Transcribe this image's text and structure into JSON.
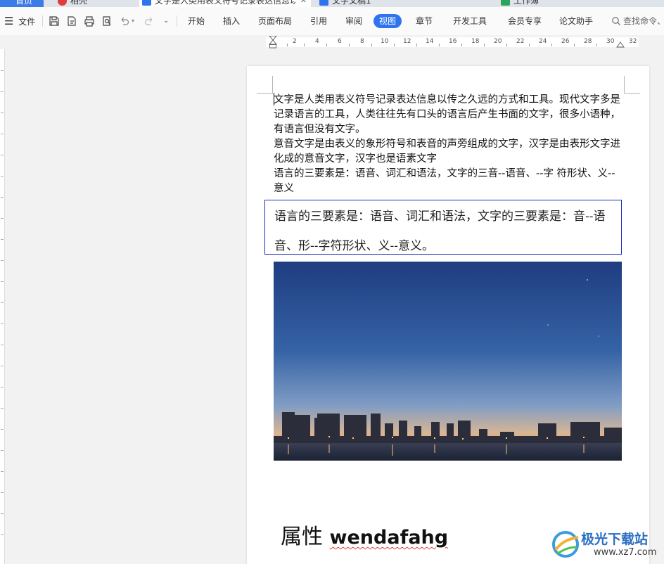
{
  "tabs": [
    {
      "label": "首页"
    },
    {
      "label": "稻壳"
    },
    {
      "label": "文字是人类用表义符号记录表达信息以传之久远的方式和工具"
    },
    {
      "label": "文字文稿1"
    },
    {
      "label": "工作簿"
    }
  ],
  "toolbar": {
    "menu_label": "文件",
    "search_label": "查找命令、",
    "menus": [
      "开始",
      "插入",
      "页面布局",
      "引用",
      "审阅",
      "视图",
      "章节",
      "开发工具",
      "会员专享",
      "论文助手"
    ],
    "active_menu": "视图"
  },
  "ruler": {
    "numbers": [
      "2",
      "2",
      "4",
      "6",
      "8",
      "10",
      "12",
      "14",
      "16",
      "18",
      "20",
      "22",
      "24",
      "26",
      "28",
      "30",
      "32"
    ]
  },
  "document": {
    "paragraphs": [
      "文字是人类用表义符号记录表达信息以传之久远的方式和工具。现代文字多是记录语言的工具，人类往往先有口头的语言后产生书面的文字，很多小语种，有语言但没有文字。",
      "意音文字是由表义的象形符号和表音的声旁组成的文字，汉字是由表形文字进化成的意音文字，汉字也是语素文字",
      "语言的三要素是：语音、词汇和语法，文字的三音--语音、--字 符形状、义--意义"
    ],
    "textbox": "语言的三要素是：语音、词汇和语法，文字的三要素是：音--语音、形--字符形状、义--意义。",
    "heading_cjk": "属性",
    "heading_latin": "wendafahg"
  },
  "watermark": {
    "brand": "极光下载站",
    "url": "www.xz7.com"
  },
  "colors": {
    "accent": "#2f73ef",
    "textbox_border": "#1a2cb8",
    "sky_top": "#2a4a8c",
    "sky_bottom": "#e9a56a"
  }
}
